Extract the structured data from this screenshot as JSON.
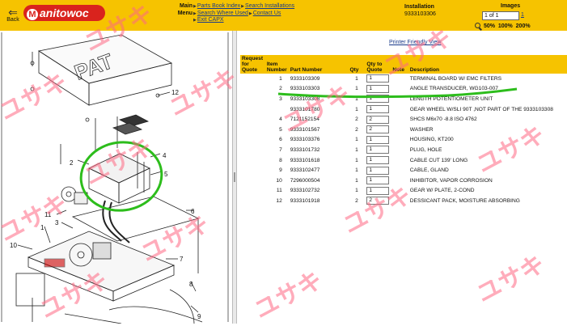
{
  "header": {
    "back_label": "Back",
    "logo_text": "anitowoc",
    "nav": {
      "main_label": "Main",
      "menu_label": "Menu",
      "links": [
        "Parts Book Index",
        "Search Installations",
        "Search Where Used",
        "Contact Us",
        "Exit CAPX"
      ]
    },
    "installation": {
      "label": "Installation",
      "value": "9333103306"
    },
    "images": {
      "label": "Images",
      "pager_value": "1 of 1",
      "page_number": "1",
      "zoom": [
        "50%",
        "100%",
        "200%"
      ]
    }
  },
  "diagram": {
    "callouts": [
      "12",
      "2",
      "4",
      "5",
      "11",
      "3",
      "6",
      "1",
      "10",
      "7",
      "8",
      "9"
    ],
    "block_label": "PAT"
  },
  "table": {
    "printer_friendly": "Printer Friendly View",
    "headers": {
      "request": "Request for Quote",
      "item": "Item Number",
      "part": "Part Number",
      "qty": "Qty",
      "qty_quote": "Qty to Quote",
      "note": "Note",
      "desc": "Description"
    },
    "rows": [
      {
        "item": "1",
        "part": "9333103309",
        "qty": "1",
        "qtq": "1",
        "desc": "TERMINAL BOARD W/ EMC FILTERS"
      },
      {
        "item": "2",
        "part": "9333103303",
        "qty": "1",
        "qtq": "1",
        "desc": "ANGLE TRANSDUCER, WG103-007"
      },
      {
        "item": "3",
        "part": "9333103308",
        "qty": "1",
        "qtq": "1",
        "desc": "LENGTH POTENTIOMETER UNIT"
      },
      {
        "item": "",
        "part": "9333101780",
        "qty": "1",
        "qtq": "1",
        "desc": "GEAR WHEEL W/SLI 90T ,NOT PART OF THE 9333103308"
      },
      {
        "item": "4",
        "part": "7121152154",
        "qty": "2",
        "qtq": "2",
        "desc": "SHCS M6x70 -8.8 ISO 4762"
      },
      {
        "item": "5",
        "part": "9333101567",
        "qty": "2",
        "qtq": "2",
        "desc": "WASHER"
      },
      {
        "item": "6",
        "part": "9333103376",
        "qty": "1",
        "qtq": "1",
        "desc": "HOUSING, KT200"
      },
      {
        "item": "7",
        "part": "9333101732",
        "qty": "1",
        "qtq": "1",
        "desc": "PLUG, HOLE"
      },
      {
        "item": "8",
        "part": "9333101618",
        "qty": "1",
        "qtq": "1",
        "desc": "CABLE CUT 139' LONG"
      },
      {
        "item": "9",
        "part": "9333102477",
        "qty": "1",
        "qtq": "1",
        "desc": "CABLE, GLAND"
      },
      {
        "item": "10",
        "part": "7296000504",
        "qty": "1",
        "qtq": "1",
        "desc": "INHIBITOR, VAPOR CORROSION"
      },
      {
        "item": "11",
        "part": "9333102732",
        "qty": "1",
        "qtq": "1",
        "desc": "GEAR W/ PLATE, 2-COND"
      },
      {
        "item": "12",
        "part": "9333101918",
        "qty": "2",
        "qtq": "2",
        "desc": "DESSICANT PACK, MOISTURE ABSORBING"
      }
    ]
  },
  "watermark_text": "ユサキ",
  "colors": {
    "header": "#f6c300",
    "link": "#1a3a8a",
    "highlight": "#2dbd1c",
    "watermark": "#ff6a84"
  }
}
